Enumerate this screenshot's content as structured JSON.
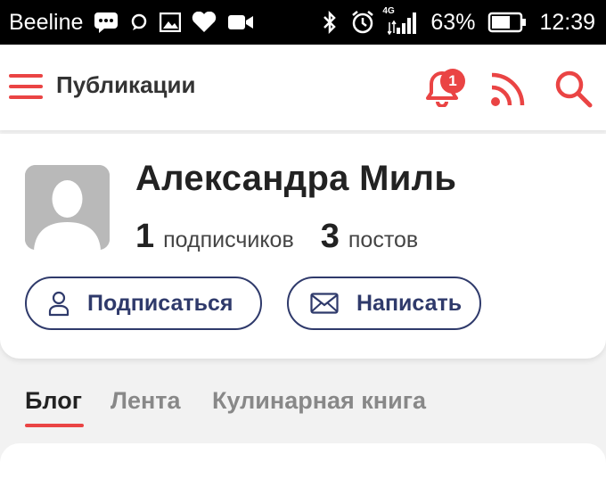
{
  "status_bar": {
    "carrier": "Beeline",
    "network": "4G",
    "battery": "63%",
    "time": "12:39",
    "icons": [
      "message-icon",
      "chat-icon",
      "image-icon",
      "heart-icon",
      "video-icon",
      "bluetooth-icon",
      "alarm-icon",
      "signal-icon",
      "battery-icon"
    ]
  },
  "app_bar": {
    "title": "Публикации",
    "notifications_count": "1",
    "icons": [
      "menu-icon",
      "bell-icon",
      "rss-icon",
      "search-icon"
    ]
  },
  "profile": {
    "name": "Александра Миль",
    "subscribers_count": "1",
    "subscribers_label": "подписчиков",
    "posts_count": "3",
    "posts_label": "постов",
    "subscribe_label": "Подписаться",
    "message_label": "Написать"
  },
  "tabs": [
    {
      "label": "Блог",
      "active": true
    },
    {
      "label": "Лента",
      "active": false
    },
    {
      "label": "Кулинарная книга",
      "active": false
    }
  ],
  "colors": {
    "accent": "#ea4444",
    "button": "#2f3a6b",
    "text": "#222222"
  }
}
